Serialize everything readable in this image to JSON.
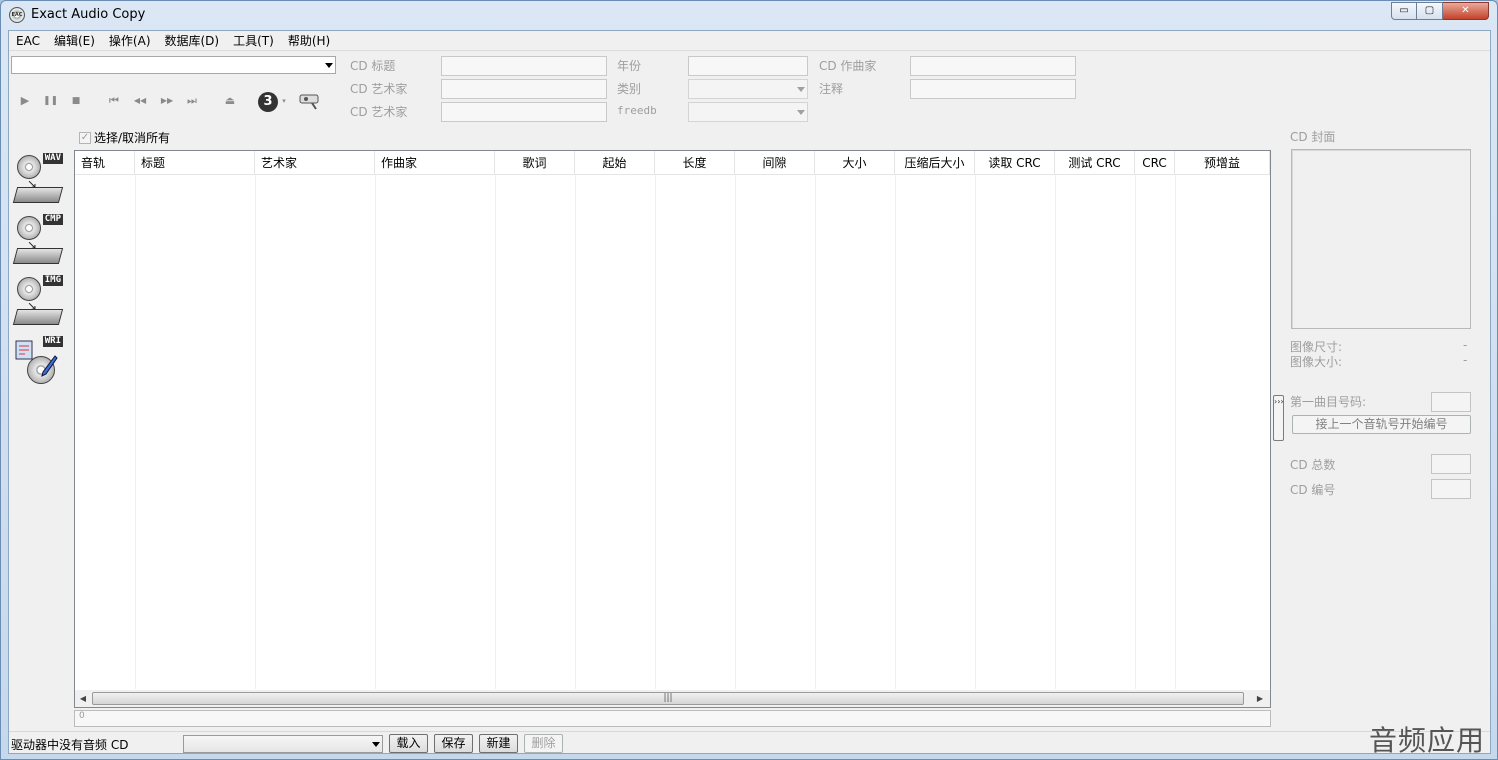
{
  "window": {
    "title": "Exact Audio Copy",
    "app_icon_text": "EAC",
    "controls": {
      "minimize": "▭",
      "maximize": "▢",
      "close": "✕"
    }
  },
  "menu": [
    "EAC",
    "编辑(E)",
    "操作(A)",
    "数据库(D)",
    "工具(T)",
    "帮助(H)"
  ],
  "cd_info": {
    "title_label": "CD 标题",
    "artist_label": "CD 艺术家",
    "artist2_label": "CD 艺术家",
    "year_label": "年份",
    "genre_label": "类别",
    "freedb_label": "freedb",
    "composer_label": "CD 作曲家",
    "comment_label": "注释"
  },
  "toolbar": {
    "play": "▶",
    "pause": "❚❚",
    "stop": "■",
    "first": "⏮",
    "prev": "◀◀",
    "next": "▶▶",
    "last": "⏭",
    "eject": "⏏",
    "cd_badge": "3"
  },
  "side_actions": [
    {
      "tag": "WAV"
    },
    {
      "tag": "CMP"
    },
    {
      "tag": "IMG"
    },
    {
      "tag": "WRI"
    }
  ],
  "select_all": {
    "label": "选择/取消所有",
    "check": "✓"
  },
  "track_table": {
    "columns": [
      "音轨",
      "标题",
      "艺术家",
      "作曲家",
      "歌词",
      "起始",
      "长度",
      "间隙",
      "大小",
      "压缩后大小",
      "读取 CRC",
      "测试 CRC",
      "CRC",
      "预增益"
    ],
    "rows": []
  },
  "scrollbar": {
    "left": "◀",
    "right": "▶",
    "grip": "|||"
  },
  "progress": {
    "label": "0"
  },
  "status": {
    "message": "驱动器中没有音频 CD",
    "load": "载入",
    "save": "保存",
    "new": "新建",
    "delete": "删除"
  },
  "right_panel": {
    "cover_label": "CD 封面",
    "image_size_label": "图像尺寸:",
    "image_size_value": "-",
    "image_bytes_label": "图像大小:",
    "image_bytes_value": "-",
    "first_track_label": "第一曲目号码:",
    "continue_numbering": "接上一个音轨号开始编号",
    "cd_total_label": "CD 总数",
    "cd_number_label": "CD 编号",
    "collapse": "›››"
  },
  "watermark": "音频应用"
}
